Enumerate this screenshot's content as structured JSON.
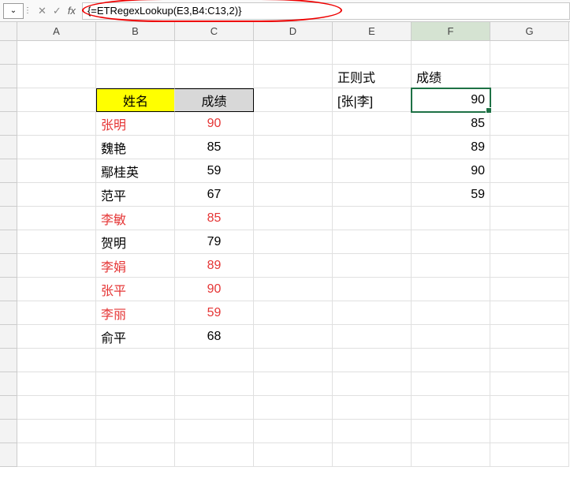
{
  "formula_bar": {
    "name_box_icon": "⌄",
    "menu_icon": "⋮",
    "cancel_icon": "✕",
    "confirm_icon": "✓",
    "fx_label": "fx",
    "formula": "{=ETRegexLookup(E3,B4:C13,2)}"
  },
  "columns": [
    "A",
    "B",
    "C",
    "D",
    "E",
    "F",
    "G"
  ],
  "row_count": 18,
  "selected_column": "F",
  "active_cell": "F3",
  "headers": {
    "name": "姓名",
    "score": "成绩",
    "regex": "正则式",
    "result": "成绩",
    "regex_value": "[张|李]"
  },
  "data_rows": [
    {
      "name": "张明",
      "score": "90",
      "red": true
    },
    {
      "name": "魏艳",
      "score": "85",
      "red": false
    },
    {
      "name": "鄢桂英",
      "score": "59",
      "red": false
    },
    {
      "name": "范平",
      "score": "67",
      "red": false
    },
    {
      "name": "李敏",
      "score": "85",
      "red": true
    },
    {
      "name": "贺明",
      "score": "79",
      "red": false
    },
    {
      "name": "李娟",
      "score": "89",
      "red": true
    },
    {
      "name": "张平",
      "score": "90",
      "red": true
    },
    {
      "name": "李丽",
      "score": "59",
      "red": true
    },
    {
      "name": "俞平",
      "score": "68",
      "red": false
    }
  ],
  "results": [
    "90",
    "85",
    "89",
    "90",
    "59"
  ]
}
